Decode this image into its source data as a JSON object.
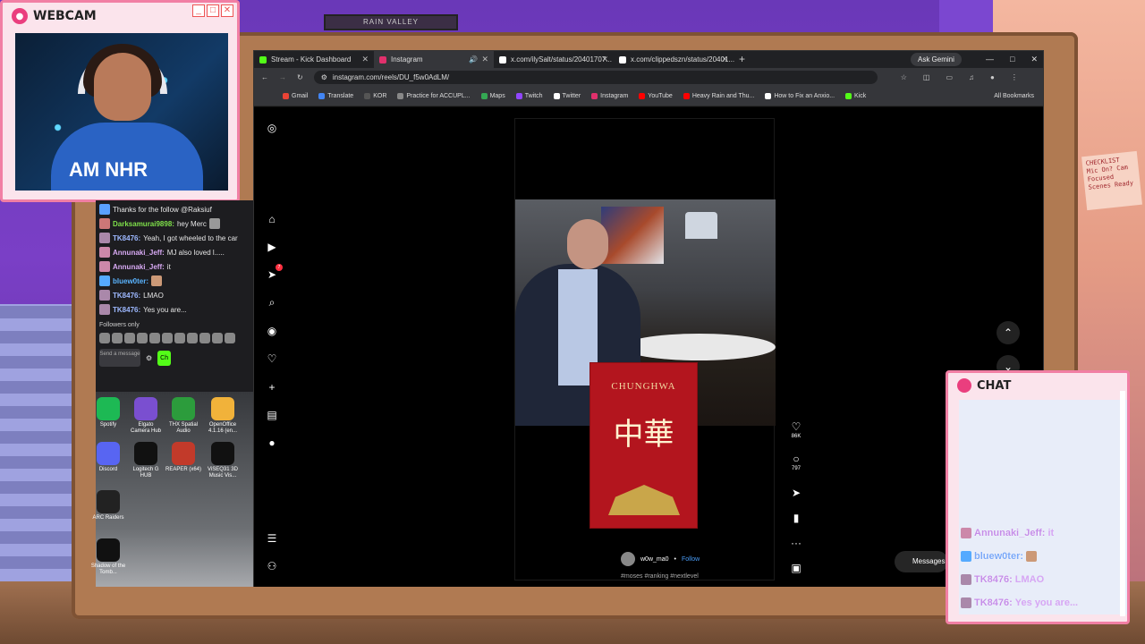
{
  "webcam": {
    "title": "WEBCAM",
    "shirt_text": "AM  NHR",
    "buttons": [
      "_",
      "□",
      "✕"
    ]
  },
  "room": {
    "top_label": "RAIN VALLEY",
    "note": "CHECKLIST Mic On? Cam Focused Scenes Ready"
  },
  "left_chat": {
    "messages": [
      {
        "user": "",
        "text": "Thanks for the follow @Raksiuf"
      },
      {
        "user": "Darksamurai9898:",
        "text": "hey Merc"
      },
      {
        "user": "TK8476:",
        "text": "Yeah, I got wheeled to the car"
      },
      {
        "user": "Annunaki_Jeff:",
        "text": "MJ also loved l....."
      },
      {
        "user": "Annunaki_Jeff:",
        "text": "it"
      },
      {
        "user": "bluew0ter:",
        "text": ""
      },
      {
        "user": "TK8476:",
        "text": "LMAO"
      },
      {
        "user": "TK8476:",
        "text": "Yes you are..."
      }
    ],
    "followers_label": "Followers only",
    "send_placeholder": "Send a message",
    "chat_button": "Ch"
  },
  "desktop_icons": [
    {
      "label": "Spotify",
      "color": "#1db954"
    },
    {
      "label": "Elgato Camera Hub",
      "color": "#7a4fd0"
    },
    {
      "label": "THX Spatial Audio",
      "color": "#2c9c3c"
    },
    {
      "label": "OpenOffice 4.1.16 (en...",
      "color": "#f1b23a"
    },
    {
      "label": "Discord",
      "color": "#5865f2"
    },
    {
      "label": "Logitech G HUB",
      "color": "#111111"
    },
    {
      "label": "REAPER (x64)",
      "color": "#c23a2a"
    },
    {
      "label": "ViSEQ31 3D Music Vis...",
      "color": "#111111"
    },
    {
      "label": "ARC Raiders",
      "color": "#222222"
    },
    {
      "label": "Shadow of the Tomb...",
      "color": "#111111"
    }
  ],
  "browser": {
    "tabs": [
      {
        "label": "Stream - Kick Dashboard",
        "color": "#53fc18",
        "active": false
      },
      {
        "label": "Instagram",
        "color": "#e1306c",
        "active": true
      },
      {
        "label": "x.com/ilySalt/status/20401707...",
        "color": "#ffffff",
        "active": false
      },
      {
        "label": "x.com/clippedszn/status/20401...",
        "color": "#ffffff",
        "active": false
      }
    ],
    "gemini": "Ask Gemini",
    "url": "instagram.com/reels/DU_f5w0AdLM/",
    "bookmarks": [
      {
        "label": "Gmail",
        "color": "#ea4335"
      },
      {
        "label": "Translate",
        "color": "#4285f4"
      },
      {
        "label": "KOR",
        "color": "#555555"
      },
      {
        "label": "Practice for ACCUPL...",
        "color": "#888888"
      },
      {
        "label": "Maps",
        "color": "#34a853"
      },
      {
        "label": "Twitch",
        "color": "#9146ff"
      },
      {
        "label": "Twitter",
        "color": "#ffffff"
      },
      {
        "label": "Instagram",
        "color": "#e1306c"
      },
      {
        "label": "YouTube",
        "color": "#ff0000"
      },
      {
        "label": "Heavy Rain and Thu...",
        "color": "#ff0000"
      },
      {
        "label": "How to Fix an Anxio...",
        "color": "#ffffff"
      },
      {
        "label": "Kick",
        "color": "#53fc18"
      }
    ],
    "all_bookmarks": "All Bookmarks"
  },
  "instagram": {
    "nav_icons": [
      "home-icon",
      "reels-icon",
      "messages-icon",
      "search-icon",
      "explore-icon",
      "heart-icon",
      "create-icon",
      "dashboard-icon",
      "profile-icon"
    ],
    "messages_badge": "7",
    "pack_brand": "CHUNGHWA",
    "pack_chinese": "中華",
    "username": "w0w_ma0",
    "follow": "Follow",
    "separator": "•",
    "hashtags": "#moses #ranking #nextlevel",
    "likes": "86K",
    "comments": "797",
    "message_label": "Messages",
    "message_badge": "5"
  },
  "chat_overlay": {
    "title": "CHAT",
    "messages": [
      {
        "user": "Annunaki_Jeff:",
        "text": "it"
      },
      {
        "user": "bluew0ter:",
        "text": ""
      },
      {
        "user": "TK8476:",
        "text": "LMAO"
      },
      {
        "user": "TK8476:",
        "text": "Yes you are..."
      }
    ]
  }
}
